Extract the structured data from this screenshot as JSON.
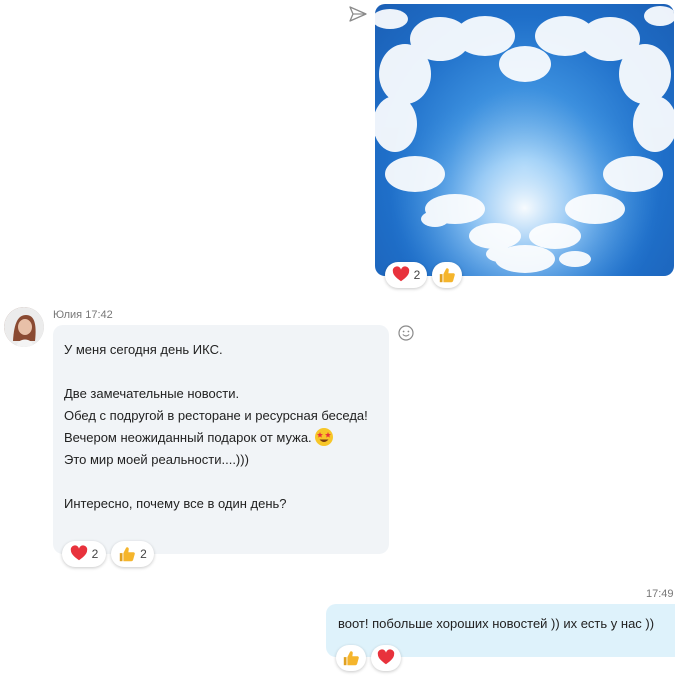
{
  "image_message": {
    "alt": "sky-heart-image",
    "reactions": [
      {
        "icon": "heart-icon",
        "count": "2"
      },
      {
        "icon": "thumbs-up-icon",
        "count": ""
      }
    ]
  },
  "incoming": {
    "sender": "Юлия",
    "time": "17:42",
    "text": "У меня сегодня день ИКС.\n\nДве замечательные новости.\nОбед с подругой в ресторане и ресурсная беседа!\nВечером неожиданный подарок от мужа.",
    "text_2": "\nЭто мир моей реальности....)))\n\nИнтересно, почему все в один день?",
    "inline_emoji": "star-struck-emoji",
    "reactions": [
      {
        "icon": "heart-icon",
        "count": "2"
      },
      {
        "icon": "thumbs-up-icon",
        "count": "2"
      }
    ]
  },
  "outgoing": {
    "time": "17:49",
    "text": "воот! побольше хороших новостей )) их есть у нас ))",
    "reactions": [
      {
        "icon": "thumbs-up-icon",
        "count": ""
      },
      {
        "icon": "heart-icon",
        "count": ""
      }
    ]
  },
  "colors": {
    "heart": "#e8323c",
    "thumb": "#f5b52c",
    "incoming_bubble": "#f1f4f7",
    "outgoing_bubble": "#def2fb"
  }
}
